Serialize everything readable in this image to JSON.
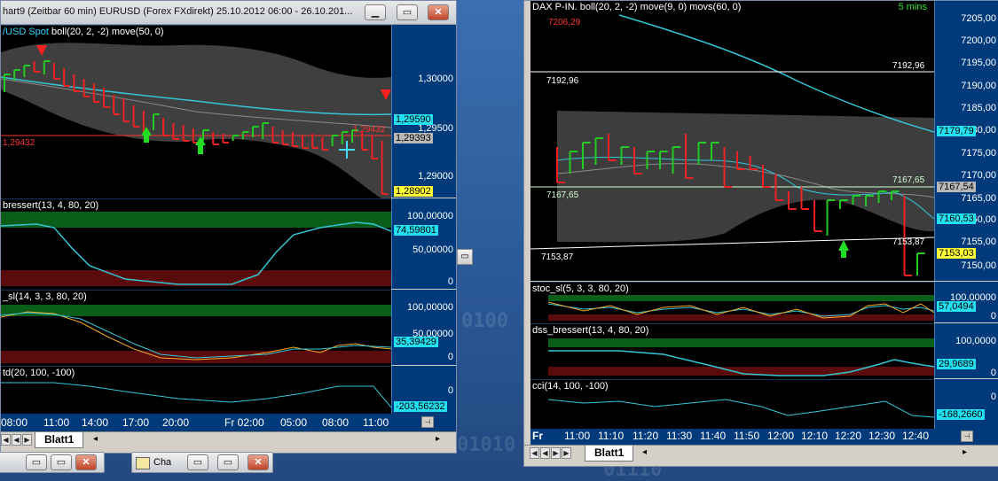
{
  "left_window": {
    "title": "hart9 (Zeitbar 60 min)  EURUSD (Forex FXdirekt) 25.10.2012 06:00 - 26.10.201...",
    "main_pane": {
      "label_symbol": "/USD Spot",
      "label_indicators": "boll(20, 2, -2) move(50, 0)",
      "timeframe": "60 mins",
      "ticks": [
        "1,30000",
        "1,29500",
        "1,29000"
      ],
      "value_boxes": [
        "1,29590",
        "1,29393",
        "1,28902"
      ],
      "level_left": "1,29432",
      "level_right": "1,29432"
    },
    "pane2": {
      "label": "bressert(13, 4, 80, 20)",
      "ticks": [
        "100,00000",
        "50,00000",
        "0"
      ],
      "value": "74,59801"
    },
    "pane3": {
      "label": "_sl(14, 3, 3, 80, 20)",
      "ticks": [
        "100,00000",
        "50,00000",
        "0"
      ],
      "value": "35,39429"
    },
    "pane4": {
      "label": "td(20, 100, -100)",
      "ticks": [
        "0"
      ],
      "value": "-203,56232"
    },
    "time_labels": [
      "08:00",
      "11:00",
      "14:00",
      "17:00",
      "20:00",
      "Fr  02:00",
      "05:00",
      "08:00",
      "11:00"
    ],
    "sheet_tab": "Blatt1"
  },
  "right_window": {
    "main_pane": {
      "label": "DAX P-IN.  boll(20, 2, -2) move(9, 0) movs(60, 0)",
      "timeframe": "5 mins",
      "ticks": [
        "7205,00",
        "7200,00",
        "7195,00",
        "7190,00",
        "7185,00",
        "7180,00",
        "7175,00",
        "7170,00",
        "7165,00",
        "7160,00",
        "7155,00",
        "7150,00"
      ],
      "value_boxes": [
        "7179,79",
        "7167,54",
        "7160,53",
        "7153,03"
      ],
      "high_mark": "7206,29",
      "level_1_left": "7192,96",
      "level_1_right": "7192,96",
      "level_2_left": "7167,65",
      "level_2_right": "7167,65",
      "level_3_left": "7153,87",
      "level_3_right": "7153,87"
    },
    "pane2": {
      "label": "stoc_sl(5, 3, 3, 80, 20)",
      "ticks": [
        "100,00000",
        "0"
      ],
      "value": "57,0494"
    },
    "pane3": {
      "label": "dss_bressert(13, 4, 80, 20)",
      "ticks": [
        "100,0000",
        "0"
      ],
      "value": "29,9689"
    },
    "pane4": {
      "label": "cci(14, 100, -100)",
      "ticks": [
        "0"
      ],
      "value": "-168,2660"
    },
    "day_label": "Fr",
    "time_labels": [
      "11:00",
      "11:10",
      "11:20",
      "11:30",
      "11:40",
      "11:50",
      "12:00",
      "12:10",
      "12:20",
      "12:30",
      "12:40"
    ],
    "sheet_tab": "Blatt1"
  },
  "taskbar": {
    "item_label": "Cha"
  },
  "colors": {
    "bull": "#22cc22",
    "bear": "#ee2222",
    "ma": "#33c6d6",
    "band": "#5a5a5a",
    "axis_bg": "#003a7a"
  }
}
